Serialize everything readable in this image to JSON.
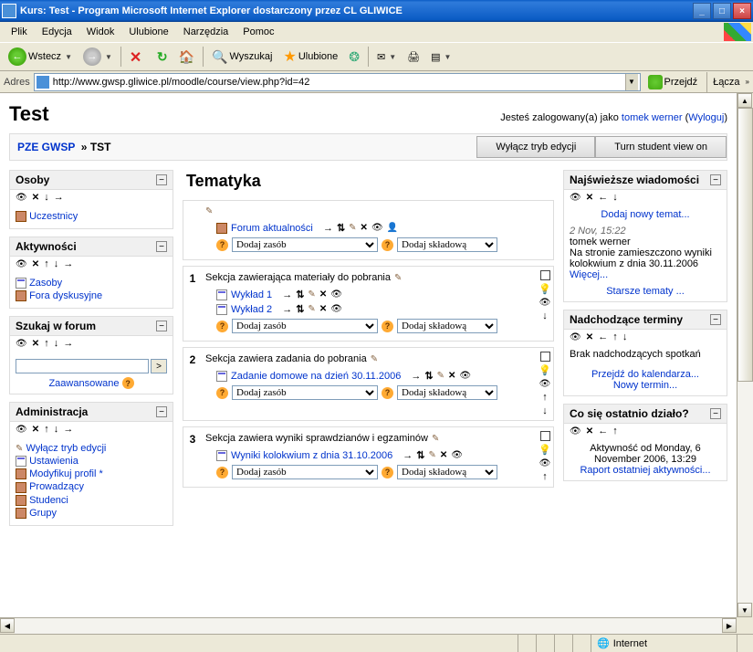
{
  "window": {
    "title": "Kurs: Test - Program Microsoft Internet Explorer dostarczony przez CL GLIWICE"
  },
  "menu": {
    "plik": "Plik",
    "edycja": "Edycja",
    "widok": "Widok",
    "ulubione": "Ulubione",
    "narzedzia": "Narzędzia",
    "pomoc": "Pomoc"
  },
  "toolbar": {
    "back": "Wstecz",
    "search": "Wyszukaj",
    "fav": "Ulubione"
  },
  "addr": {
    "label": "Adres",
    "url": "http://www.gwsp.gliwice.pl/moodle/course/view.php?id=42",
    "go": "Przejdź",
    "links": "Łącza"
  },
  "page": {
    "title": "Test",
    "login_prefix": "Jesteś zalogowany(a) jako ",
    "username": "tomek werner",
    "logout": "Wyloguj"
  },
  "breadcrumb": {
    "root": "PZE GWSP",
    "current": "TST"
  },
  "navbtn": {
    "editoff": "Wyłącz tryb edycji",
    "studentview": "Turn student view on"
  },
  "blocks": {
    "osoby": {
      "title": "Osoby",
      "uczestnicy": "Uczestnicy"
    },
    "aktywnosci": {
      "title": "Aktywności",
      "zasoby": "Zasoby",
      "fora": "Fora dyskusyjne"
    },
    "szukaj": {
      "title": "Szukaj w forum",
      "adv": "Zaawansowane"
    },
    "admin": {
      "title": "Administracja",
      "items": [
        "Wyłącz tryb edycji",
        "Ustawienia",
        "Modyfikuj profil",
        "Prowadzący",
        "Studenci",
        "Grupy"
      ]
    },
    "news": {
      "title": "Najświeższe wiadomości",
      "addnew": "Dodaj nowy temat...",
      "date": "2 Nov, 15:22",
      "author": "tomek werner",
      "text": "Na stronie zamieszczono wyniki kolokwium z dnia 30.11.2006 ",
      "more": "Więcej...",
      "older": "Starsze tematy ..."
    },
    "upcoming": {
      "title": "Nadchodzące terminy",
      "empty": "Brak nadchodzących spotkań",
      "cal": "Przejdź do kalendarza...",
      "new": "Nowy termin..."
    },
    "recent": {
      "title": "Co się ostatnio działo?",
      "since": "Aktywność od Monday, 6 November 2006, 13:29",
      "report": "Raport ostatniej aktywności..."
    }
  },
  "mid": {
    "title": "Tematyka",
    "add_resource": "Dodaj zasób",
    "add_component": "Dodaj składową",
    "s0": {
      "forum": "Forum aktualności"
    },
    "s1": {
      "summary": "Sekcja zawierająca materiały do pobrania",
      "w1": "Wykład 1",
      "w2": "Wykład 2"
    },
    "s2": {
      "summary": "Sekcja zawiera zadania do pobrania",
      "hw": "Zadanie domowe na dzień 30.11.2006"
    },
    "s3": {
      "summary": "Sekcja zawiera wyniki sprawdzianów i egzaminów",
      "res": "Wyniki kolokwium z dnia 31.10.2006"
    }
  },
  "status": {
    "zone": "Internet"
  }
}
